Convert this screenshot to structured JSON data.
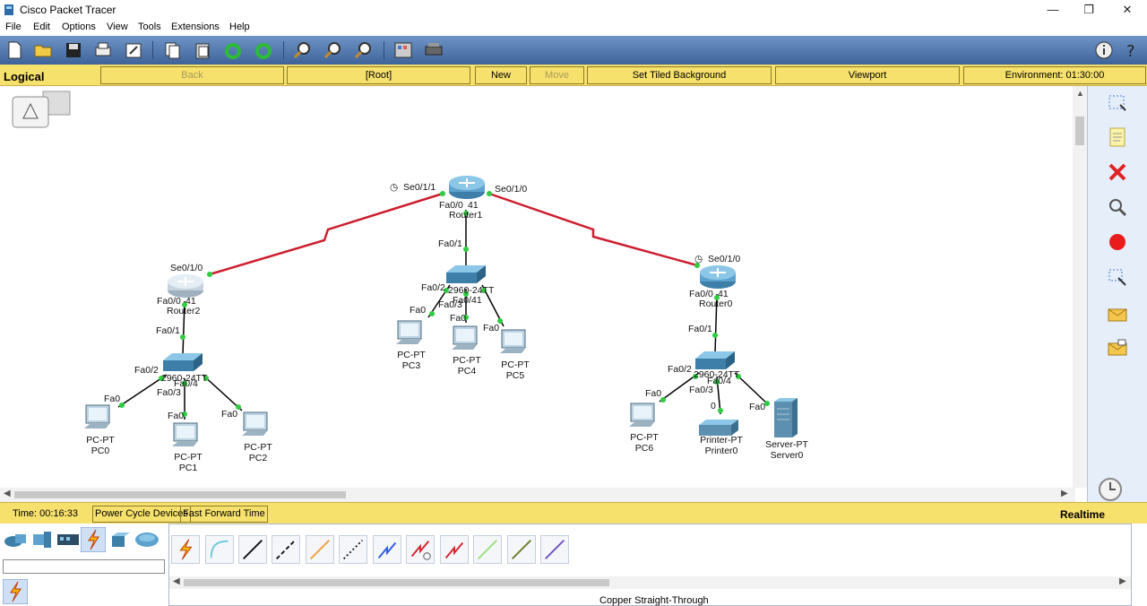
{
  "window": {
    "title": "Cisco Packet Tracer",
    "minimize": "—",
    "restore": "❐",
    "close": "✕"
  },
  "menu": [
    "File",
    "Edit",
    "Options",
    "View",
    "Tools",
    "Extensions",
    "Help"
  ],
  "navbar": {
    "mode": "Logical",
    "back": "Back",
    "root": "[Root]",
    "new_cluster": "New Cluster",
    "move_object": "Move Object",
    "tiled_bg": "Set Tiled Background",
    "viewport": "Viewport",
    "environment": "Environment: 01:30:00"
  },
  "colors": {
    "serial_link": "#cc1f2f",
    "ethernet_link": "#000000",
    "port_up": "#2ecc40",
    "toolbar": "#4f76a8",
    "navbar": "#f7e16d"
  },
  "topology": {
    "routers": [
      {
        "name": "Router1",
        "fa": "Fa0/0",
        "extra": "41",
        "se_left": "Se0/1/1",
        "se_right": "Se0/1/0"
      },
      {
        "name": "Router2",
        "fa": "Fa0/0",
        "extra": "41",
        "se": "Se0/1/0"
      },
      {
        "name": "Router0",
        "fa": "Fa0/0",
        "extra": "41",
        "se": "Se0/1/0"
      }
    ],
    "switch_port_labels": {
      "sw2": [
        "Fa0/1",
        "Fa0/2",
        "2960-24TT",
        "Fa0/4",
        "Fa0/3"
      ],
      "sw1": [
        "Fa0/1",
        "Fa0/2",
        "2960-24TT",
        "Fa0/41",
        "Fa0/3"
      ],
      "sw0": [
        "Fa0/1",
        "Fa0/2",
        "2960-24TT",
        "Fa0/4",
        "Fa0/3"
      ]
    },
    "end_devices": [
      {
        "type": "PC-PT",
        "name": "PC0",
        "port": "Fa0"
      },
      {
        "type": "PC-PT",
        "name": "PC1",
        "port": "Fa0"
      },
      {
        "type": "PC-PT",
        "name": "PC2",
        "port": "Fa0"
      },
      {
        "type": "PC-PT",
        "name": "PC3",
        "port": "Fa0"
      },
      {
        "type": "PC-PT",
        "name": "PC4",
        "port": "Fa0"
      },
      {
        "type": "PC-PT",
        "name": "PC5",
        "port": "Fa0"
      },
      {
        "type": "PC-PT",
        "name": "PC6",
        "port": "Fa0"
      },
      {
        "type": "Printer-PT",
        "name": "Printer0",
        "port": "0"
      },
      {
        "type": "Server-PT",
        "name": "Server0",
        "port": "Fa0"
      }
    ]
  },
  "status": {
    "time": "Time: 00:16:33",
    "power_cycle": "Power Cycle Devices",
    "fast_forward": "Fast Forward Time",
    "mode": "Realtime"
  },
  "connection_selected": "Copper Straight-Through",
  "device_search_value": ""
}
